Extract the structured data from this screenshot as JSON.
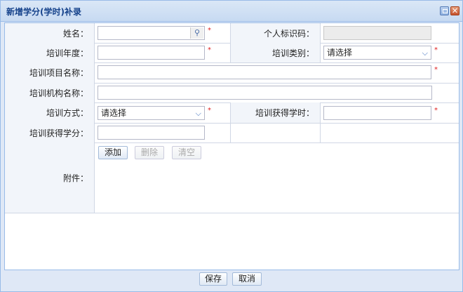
{
  "window": {
    "title": "新增学分(学时)补录"
  },
  "form": {
    "name_label": "姓名：",
    "id_label": "个人标识码：",
    "year_label": "培训年度：",
    "type_label": "培训类别：",
    "type_value": "请选择",
    "project_label": "培训项目名称：",
    "org_label": "培训机构名称：",
    "method_label": "培训方式：",
    "method_value": "请选择",
    "hours_label": "培训获得学时：",
    "credits_label": "培训获得学分：",
    "attachment_label": "附件："
  },
  "attachment_buttons": {
    "add": "添加",
    "delete": "删除",
    "clear": "清空"
  },
  "footer": {
    "save": "保存",
    "cancel": "取消"
  },
  "required_mark": "*"
}
